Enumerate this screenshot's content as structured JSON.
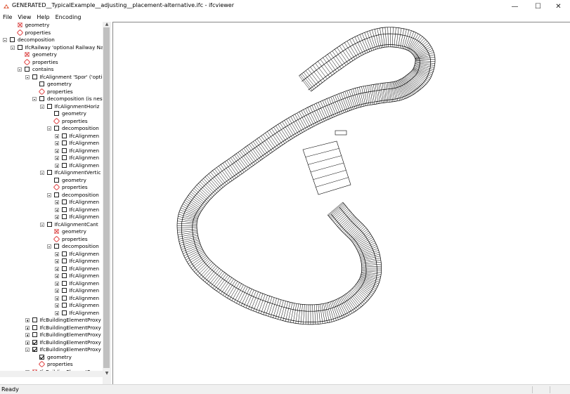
{
  "window": {
    "title": "GENERATED__TypicalExample__adjusting__placement-alternative.ifc - ifcviewer",
    "minimize": "—",
    "maximize": "☐",
    "close": "✕"
  },
  "menu": [
    "File",
    "View",
    "Help",
    "Encoding"
  ],
  "tree": [
    {
      "depth": 2,
      "exp": null,
      "icon": "x",
      "label": "geometry"
    },
    {
      "depth": 2,
      "exp": null,
      "icon": "tag",
      "label": "properties"
    },
    {
      "depth": 1,
      "exp": "minus",
      "icon": "box",
      "label": "decomposition"
    },
    {
      "depth": 2,
      "exp": "minus",
      "icon": "box",
      "label": "IfcRailway 'optional Railway Nam"
    },
    {
      "depth": 3,
      "exp": null,
      "icon": "x",
      "label": "geometry"
    },
    {
      "depth": 3,
      "exp": null,
      "icon": "tag",
      "label": "properties"
    },
    {
      "depth": 3,
      "exp": "minus",
      "icon": "box",
      "label": "contains"
    },
    {
      "depth": 4,
      "exp": "minus",
      "icon": "box",
      "label": "IfcAlignment 'Spor' ('optio"
    },
    {
      "depth": 5,
      "exp": null,
      "icon": "box",
      "label": "geometry"
    },
    {
      "depth": 5,
      "exp": null,
      "icon": "tag",
      "label": "properties"
    },
    {
      "depth": 5,
      "exp": "minus",
      "icon": "box",
      "label": "decomposition (is nest"
    },
    {
      "depth": 6,
      "exp": "minus",
      "icon": "box",
      "label": "IfcAlignmentHoriz"
    },
    {
      "depth": 7,
      "exp": null,
      "icon": "box",
      "label": "geometry"
    },
    {
      "depth": 7,
      "exp": null,
      "icon": "tag",
      "label": "properties"
    },
    {
      "depth": 7,
      "exp": "minus",
      "icon": "box",
      "label": "decomposition"
    },
    {
      "depth": 8,
      "exp": "plus",
      "icon": "box",
      "label": "IfcAlignmen"
    },
    {
      "depth": 8,
      "exp": "plus",
      "icon": "box",
      "label": "IfcAlignmen"
    },
    {
      "depth": 8,
      "exp": "plus",
      "icon": "box",
      "label": "IfcAlignmen"
    },
    {
      "depth": 8,
      "exp": "plus",
      "icon": "box",
      "label": "IfcAlignmen"
    },
    {
      "depth": 8,
      "exp": "plus",
      "icon": "box",
      "label": "IfcAlignmen"
    },
    {
      "depth": 6,
      "exp": "minus",
      "icon": "box",
      "label": "IfcAlignmentVertic"
    },
    {
      "depth": 7,
      "exp": null,
      "icon": "box",
      "label": "geometry"
    },
    {
      "depth": 7,
      "exp": null,
      "icon": "tag",
      "label": "properties"
    },
    {
      "depth": 7,
      "exp": "minus",
      "icon": "box",
      "label": "decomposition"
    },
    {
      "depth": 8,
      "exp": "plus",
      "icon": "box",
      "label": "IfcAlignmen"
    },
    {
      "depth": 8,
      "exp": "plus",
      "icon": "box",
      "label": "IfcAlignmen"
    },
    {
      "depth": 8,
      "exp": "plus",
      "icon": "box",
      "label": "IfcAlignmen"
    },
    {
      "depth": 6,
      "exp": "minus",
      "icon": "box",
      "label": "IfcAlignmentCant"
    },
    {
      "depth": 7,
      "exp": null,
      "icon": "x",
      "label": "geometry"
    },
    {
      "depth": 7,
      "exp": null,
      "icon": "tag",
      "label": "properties"
    },
    {
      "depth": 7,
      "exp": "minus",
      "icon": "box",
      "label": "decomposition"
    },
    {
      "depth": 8,
      "exp": "plus",
      "icon": "box",
      "label": "IfcAlignmen"
    },
    {
      "depth": 8,
      "exp": "plus",
      "icon": "box",
      "label": "IfcAlignmen"
    },
    {
      "depth": 8,
      "exp": "plus",
      "icon": "box",
      "label": "IfcAlignmen"
    },
    {
      "depth": 8,
      "exp": "plus",
      "icon": "box",
      "label": "IfcAlignmen"
    },
    {
      "depth": 8,
      "exp": "plus",
      "icon": "box",
      "label": "IfcAlignmen"
    },
    {
      "depth": 8,
      "exp": "plus",
      "icon": "box",
      "label": "IfcAlignmen"
    },
    {
      "depth": 8,
      "exp": "plus",
      "icon": "box",
      "label": "IfcAlignmen"
    },
    {
      "depth": 8,
      "exp": "plus",
      "icon": "box",
      "label": "IfcAlignmen"
    },
    {
      "depth": 8,
      "exp": "plus",
      "icon": "box",
      "label": "IfcAlignmen"
    },
    {
      "depth": 4,
      "exp": "plus",
      "icon": "box",
      "label": "IfcBuildingElementProxy '"
    },
    {
      "depth": 4,
      "exp": "plus",
      "icon": "box",
      "label": "IfcBuildingElementProxy '"
    },
    {
      "depth": 4,
      "exp": "plus",
      "icon": "box",
      "label": "IfcBuildingElementProxy '"
    },
    {
      "depth": 4,
      "exp": "plus",
      "icon": "checked",
      "label": "IfcBuildingElementProxy '"
    },
    {
      "depth": 4,
      "exp": "minus",
      "icon": "checked",
      "label": "IfcBuildingElementProxy '"
    },
    {
      "depth": 5,
      "exp": null,
      "icon": "checked",
      "label": "geometry"
    },
    {
      "depth": 5,
      "exp": null,
      "icon": "tag",
      "label": "properties"
    },
    {
      "depth": 4,
      "exp": "plus",
      "icon": "x",
      "label": "IfcBuildingElementProxy '"
    }
  ],
  "status": {
    "text": "Ready"
  }
}
